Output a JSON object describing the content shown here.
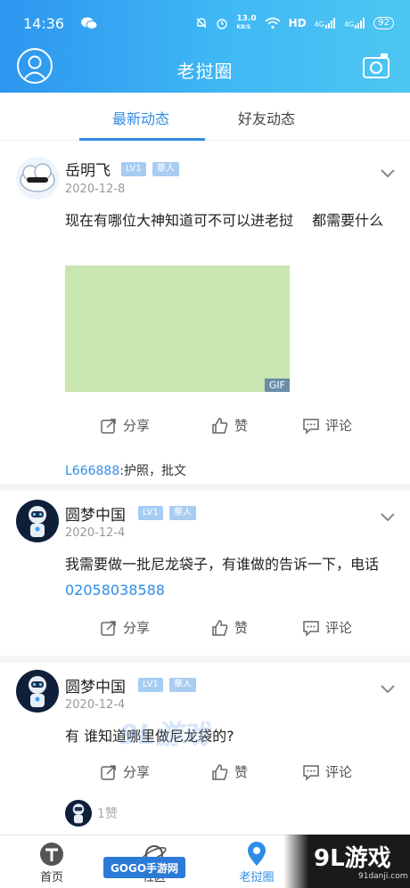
{
  "status_bar": {
    "time": "14:36",
    "network_speed": "13.0",
    "network_unit": "KB/S",
    "hd_label": "HD",
    "signal1": "4G",
    "signal2": "4G",
    "battery": "92"
  },
  "header": {
    "title": "老挝圈"
  },
  "tabs": [
    {
      "label": "最新动态",
      "active": true
    },
    {
      "label": "好友动态",
      "active": false
    }
  ],
  "posts": [
    {
      "username": "岳明飞",
      "level": "LV1",
      "role": "華人",
      "date": "2020-12-8",
      "content": "现在有哪位大神知道可不可以进老挝 　都需要什么",
      "media_tag": "GIF",
      "actions": {
        "share": "分享",
        "like": "赞",
        "comment": "评论"
      },
      "comment": {
        "user": "L666888",
        "text": ":护照，批文"
      }
    },
    {
      "username": "圆梦中国",
      "level": "LV1",
      "role": "華人",
      "date": "2020-12-4",
      "content_prefix": "我需要做一批尼龙袋子，有谁做的告诉一下，电话",
      "phone": "02058038588",
      "actions": {
        "share": "分享",
        "like": "赞",
        "comment": "评论"
      }
    },
    {
      "username": "圆梦中国",
      "level": "LV1",
      "role": "華人",
      "date": "2020-12-4",
      "content": "有 谁知道哪里做尼龙袋的?",
      "actions": {
        "share": "分享",
        "like": "赞",
        "comment": "评论"
      },
      "likes": "1赞"
    }
  ],
  "bottom_nav": [
    {
      "label": "首页",
      "icon": "home-t-icon",
      "active": false
    },
    {
      "label": "社区",
      "icon": "planet-icon",
      "active": false
    },
    {
      "label": "老挝圈",
      "icon": "location-pin-icon",
      "active": true
    }
  ],
  "watermarks": {
    "center": "9L游戏",
    "badge": "GOGO手游网",
    "corner_big": "9L游戏",
    "corner_url": "91danji.com"
  },
  "colors": {
    "accent": "#2f8ce8",
    "header_start": "#2d96f0",
    "header_end": "#4ec6f2",
    "gif_placeholder": "#c9e5b0"
  }
}
